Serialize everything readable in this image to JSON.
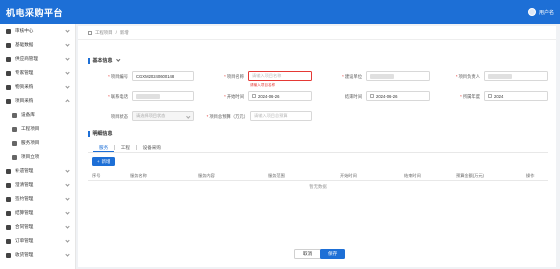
{
  "app": {
    "title": "机电采购平台",
    "user_name": "用户名"
  },
  "sidebar": {
    "items": [
      {
        "label": "审核中心"
      },
      {
        "label": "基础数据"
      },
      {
        "label": "供应商管理"
      },
      {
        "label": "专家管理"
      },
      {
        "label": "物资采购"
      },
      {
        "label": "项目采购"
      },
      {
        "label": "设备库"
      },
      {
        "label": "工程项目"
      },
      {
        "label": "服务项目"
      },
      {
        "label": "项目立项"
      },
      {
        "label": "补遗管理"
      },
      {
        "label": "澄清管理"
      },
      {
        "label": "签约管理"
      },
      {
        "label": "结算管理"
      },
      {
        "label": "合同管理"
      },
      {
        "label": "订单管理"
      },
      {
        "label": "收货管理"
      }
    ]
  },
  "breadcrumb": {
    "parent": "工程项目",
    "current": "新增"
  },
  "basic_info": {
    "title": "基本信息",
    "project_code": {
      "label": "项目编号",
      "value": "CGXM20240600148"
    },
    "project_name": {
      "label": "项目名称",
      "placeholder": "请输入项目名称",
      "error": "请输入项目名称"
    },
    "build_unit": {
      "label": "建设单位"
    },
    "project_leader": {
      "label": "项目负责人"
    },
    "contact_phone": {
      "label": "联系电话"
    },
    "start_time": {
      "label": "开始时间",
      "value": "2024-06-26"
    },
    "end_time": {
      "label": "结束时间",
      "value": "2024-06-26"
    },
    "year": {
      "label": "所属年度",
      "value": "2024"
    },
    "project_status": {
      "label": "项目状态",
      "placeholder": "请选择项目状态"
    },
    "budget": {
      "label": "项目总预算（万元）",
      "placeholder": "请输入项目总预算"
    }
  },
  "detail_info": {
    "title": "明细信息",
    "tabs": [
      "服务",
      "工程",
      "设备采购"
    ],
    "add_button": "新增",
    "columns": [
      "序号",
      "服务名称",
      "服务内容",
      "服务范围",
      "开始时间",
      "结束时间",
      "预算金额(万元)",
      "操作"
    ],
    "empty_text": "暂无数据"
  },
  "footer": {
    "cancel": "取消",
    "save": "保存"
  },
  "colors": {
    "primary": "#1d6fd6",
    "error": "#e53935"
  }
}
